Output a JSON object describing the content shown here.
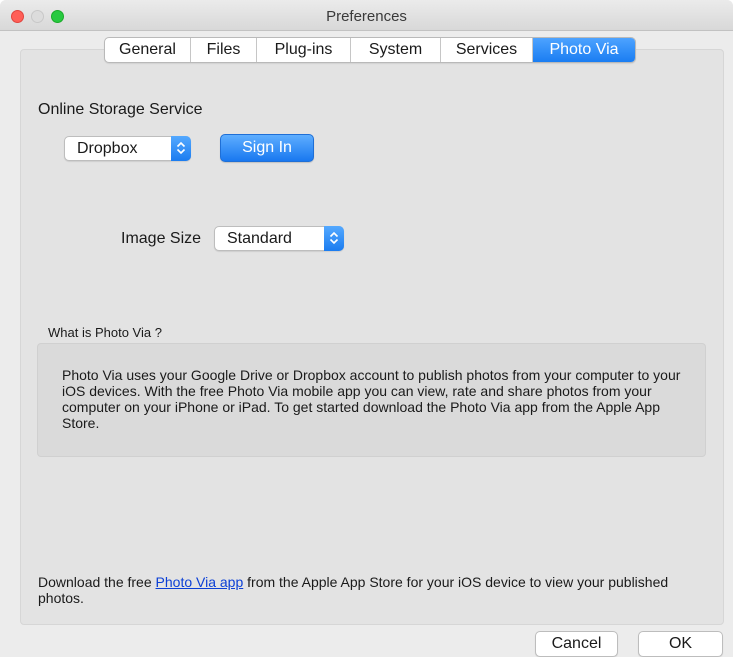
{
  "window": {
    "title": "Preferences"
  },
  "tabs": [
    {
      "label": "General",
      "active": false
    },
    {
      "label": "Files",
      "active": false
    },
    {
      "label": "Plug-ins",
      "active": false
    },
    {
      "label": "System",
      "active": false
    },
    {
      "label": "Services",
      "active": false
    },
    {
      "label": "Photo Via",
      "active": true
    }
  ],
  "storage": {
    "heading": "Online Storage Service",
    "service_value": "Dropbox",
    "sign_in_label": "Sign In"
  },
  "image_size": {
    "label": "Image Size",
    "value": "Standard"
  },
  "about": {
    "heading": "What is Photo Via ?",
    "body": "Photo Via uses your Google Drive or Dropbox account to publish photos from your computer to your iOS devices. With the free Photo Via mobile app you can view, rate and share photos from your computer on your iPhone or iPad. To get started download the Photo Via app from the Apple App Store."
  },
  "footer": {
    "text_before": "Download the free ",
    "link_label": "Photo Via app",
    "text_after": " from the Apple App Store for your iOS device to view your published photos."
  },
  "buttons": {
    "cancel_label": "Cancel",
    "ok_label": "OK"
  },
  "colors": {
    "accent": "#1a7df2",
    "link": "#0b3fd6",
    "close": "#ff5f57",
    "zoom": "#28c940"
  }
}
